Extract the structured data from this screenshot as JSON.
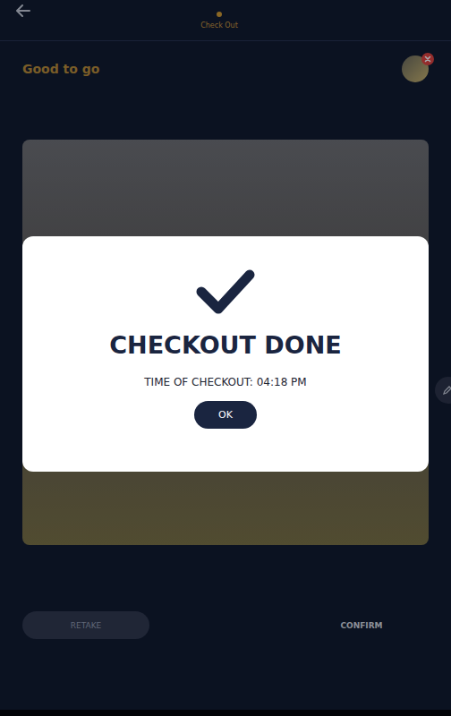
{
  "header": {
    "steps": [
      {
        "label": "Check Out",
        "selected": true
      }
    ]
  },
  "page": {
    "heading": "Good to go"
  },
  "modal": {
    "title": "CHECKOUT DONE",
    "time": "TIME OF CHECKOUT: 04:18 PM",
    "button": "OK"
  },
  "buttons": [
    {
      "label": "RETAKE",
      "disabled": true
    },
    {
      "label": "CONFIRM",
      "disabled": false
    }
  ]
}
